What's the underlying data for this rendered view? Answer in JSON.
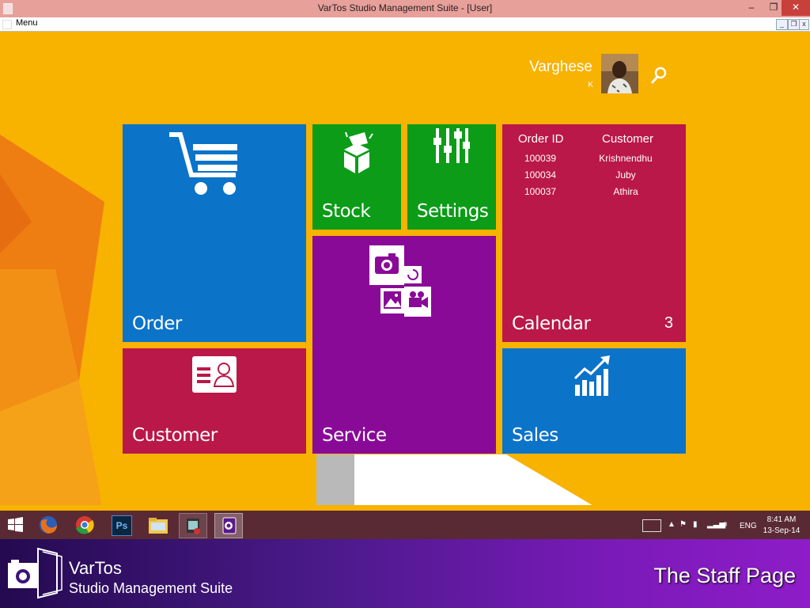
{
  "window": {
    "title": "VarTos Studio Management Suite  - [User]",
    "min": "–",
    "max": "❐",
    "close": "✕"
  },
  "menubar": {
    "menu_label": "Menu"
  },
  "user": {
    "name": "Varghese",
    "subtitle": "K"
  },
  "tiles": {
    "order": {
      "label": "Order",
      "color": "#0b73c8"
    },
    "stock": {
      "label": "Stock",
      "color": "#0c9c18"
    },
    "settings": {
      "label": "Settings",
      "color": "#0c9c18"
    },
    "service": {
      "label": "Service",
      "color": "#8a0a98"
    },
    "customer": {
      "label": "Customer",
      "color": "#ba1848"
    },
    "calendar": {
      "label": "Calendar",
      "count": "3",
      "color": "#ba1848",
      "headers": [
        "Order ID",
        "Customer"
      ],
      "rows": [
        [
          "100039",
          "Krishnendhu"
        ],
        [
          "100034",
          "Juby"
        ],
        [
          "100037",
          "Athira"
        ]
      ]
    },
    "sales": {
      "label": "Sales",
      "color": "#0b73c8"
    }
  },
  "taskbar": {
    "icons": [
      "windows-start-icon",
      "firefox-icon",
      "chrome-icon",
      "photoshop-icon",
      "file-explorer-icon",
      "app-icon",
      "vartos-app-icon"
    ],
    "photoshop_text": "Ps",
    "lang": "ENG",
    "time": "8:41 AM",
    "date": "13-Sep-14"
  },
  "footer": {
    "brand": "VarTos",
    "tagline": "Studio Management Suite",
    "page_title": "The Staff Page"
  }
}
